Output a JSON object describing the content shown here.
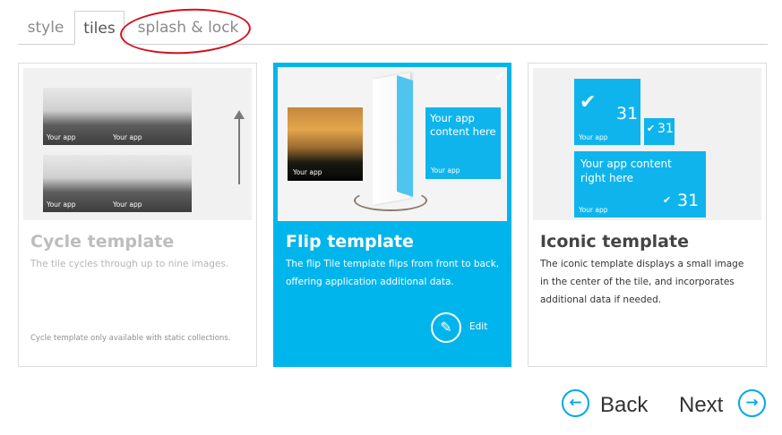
{
  "tabs": {
    "style": "style",
    "tiles": "tiles",
    "splash_lock": "splash & lock"
  },
  "cards": {
    "cycle": {
      "title": "Cycle template",
      "description": "The tile cycles through up to nine images.",
      "note": "Cycle template only available with static collections.",
      "tile_label": "Your app"
    },
    "flip": {
      "title": "Flip template",
      "description": "The flip Tile template flips from front to back, offering application additional data.",
      "tile_label": "Your app",
      "back_tile_text": "Your app content here",
      "back_tile_label": "Your app",
      "edit_label": "Edit",
      "selected": true
    },
    "iconic": {
      "title": "Iconic template",
      "description": "The iconic template displays a small image in the center of the tile, and incorporates additional data if needed.",
      "big_count": "31",
      "small_count": "31",
      "wide_count": "31",
      "wide_text": "Your app content right here",
      "tile_label": "Your app"
    }
  },
  "nav": {
    "back_label": "Back",
    "next_label": "Next"
  },
  "colors": {
    "accent": "#00b5ec",
    "annotation": "#d0121e"
  },
  "icons": {
    "check": "check-icon",
    "edit": "pencil-icon",
    "back": "arrow-left-circle-icon",
    "next": "arrow-right-circle-icon"
  }
}
